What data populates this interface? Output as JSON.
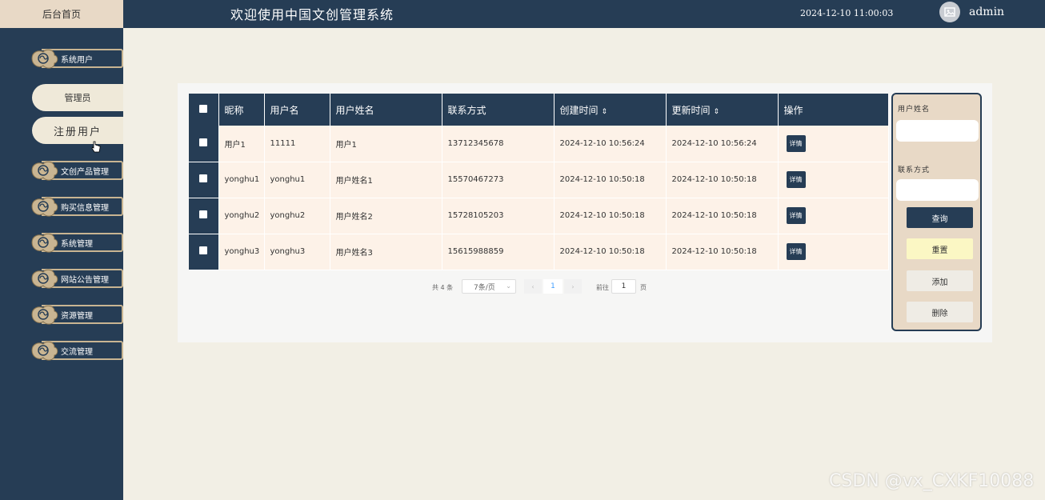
{
  "header": {
    "home_tab": "后台首页",
    "title": "欢迎使用中国文创管理系统",
    "datetime": "2024-12-10 11:00:03",
    "username": "admin",
    "avatar_icon": "image-placeholder-icon"
  },
  "sidebar": {
    "menu": [
      {
        "label": "系统用户"
      },
      {
        "label": "文创产品管理"
      },
      {
        "label": "购买信息管理"
      },
      {
        "label": "系统管理"
      },
      {
        "label": "网站公告管理"
      },
      {
        "label": "资源管理"
      },
      {
        "label": "交流管理"
      }
    ],
    "sub_items": [
      {
        "label": "管理员"
      },
      {
        "label": "注册用户"
      }
    ]
  },
  "table": {
    "headers": [
      "昵称",
      "用户名",
      "用户姓名",
      "联系方式",
      "创建时间",
      "更新时间",
      "操作"
    ],
    "sort_icon": "⇕",
    "detail_label": "详情",
    "rows": [
      {
        "nickname": "用户1",
        "username": "11111",
        "realname": "用户1",
        "phone": "13712345678",
        "created": "2024-12-10 10:56:24",
        "updated": "2024-12-10 10:56:24"
      },
      {
        "nickname": "yonghu1",
        "username": "yonghu1",
        "realname": "用户姓名1",
        "phone": "15570467273",
        "created": "2024-12-10 10:50:18",
        "updated": "2024-12-10 10:50:18"
      },
      {
        "nickname": "yonghu2",
        "username": "yonghu2",
        "realname": "用户姓名2",
        "phone": "15728105203",
        "created": "2024-12-10 10:50:18",
        "updated": "2024-12-10 10:50:18"
      },
      {
        "nickname": "yonghu3",
        "username": "yonghu3",
        "realname": "用户姓名3",
        "phone": "15615988859",
        "created": "2024-12-10 10:50:18",
        "updated": "2024-12-10 10:50:18"
      }
    ]
  },
  "pagination": {
    "total": "共 4 条",
    "page_size": "7条/页",
    "prev": "‹",
    "current": "1",
    "next": "›",
    "goto": "前往",
    "goto_value": "1",
    "page_suffix": "页"
  },
  "search": {
    "name_label": "用户姓名",
    "phone_label": "联系方式",
    "query": "查询",
    "reset": "重置",
    "add": "添加",
    "delete": "删除"
  },
  "watermark": "CSDN @vx_CXKF10088",
  "colors": {
    "navy": "#263d55",
    "beige": "#e8d9c6",
    "row_bg": "#fdf2e8",
    "reset_yellow": "#fbf7c4"
  }
}
